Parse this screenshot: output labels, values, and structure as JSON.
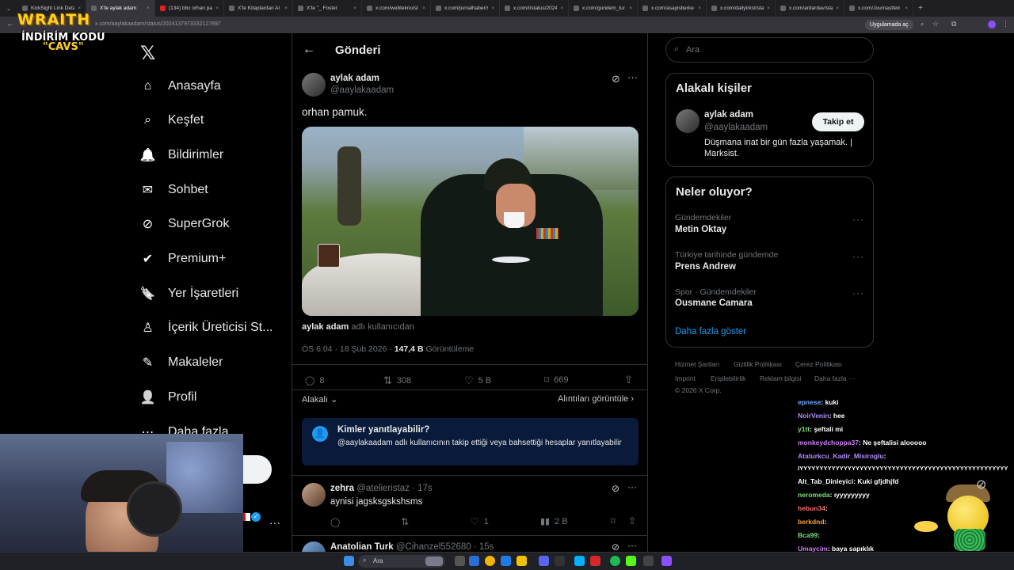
{
  "browser": {
    "tabs": [
      {
        "label": "KickSight Link Deta"
      },
      {
        "label": "X'te aylak adam"
      },
      {
        "label": "(134) bbc orhan pa"
      },
      {
        "label": "X'te Kitaplardan Al"
      },
      {
        "label": "X'te \"_ Foster"
      },
      {
        "label": "x.com/webtekno/st"
      },
      {
        "label": "x.com/jurnalhaber/st"
      },
      {
        "label": "x.com/i/status/2024"
      },
      {
        "label": "x.com/gundem_tur"
      },
      {
        "label": "x.com/asayisberke"
      },
      {
        "label": "x.com/dailytrkst/sta"
      },
      {
        "label": "x.com/ardardav/sta"
      },
      {
        "label": "x.com/Journasttetr"
      }
    ],
    "url": "x.com/aaylakaadam/status/2024137973332127897",
    "app_button": "Uygulamada aç"
  },
  "overlay": {
    "brand": "WRAITH",
    "code_line1": "İNDİRİM KODU",
    "code_line2": "\"CAVS\""
  },
  "nav": [
    {
      "label": "Anasayfa",
      "icon": "home-icon"
    },
    {
      "label": "Keşfet",
      "icon": "search-icon"
    },
    {
      "label": "Bildirimler",
      "icon": "bell-icon"
    },
    {
      "label": "Sohbet",
      "icon": "mail-icon"
    },
    {
      "label": "SuperGrok",
      "icon": "grok-icon"
    },
    {
      "label": "Premium+",
      "icon": "verified-icon"
    },
    {
      "label": "Yer İşaretleri",
      "icon": "bookmark-icon"
    },
    {
      "label": "İçerik Üreticisi St...",
      "icon": "creator-icon"
    },
    {
      "label": "Makaleler",
      "icon": "article-icon"
    },
    {
      "label": "Profil",
      "icon": "person-icon"
    },
    {
      "label": "Daha fazla",
      "icon": "more-icon"
    }
  ],
  "post_header": {
    "title": "Gönderi"
  },
  "post": {
    "name": "aylak adam",
    "handle": "@aaylakaadam",
    "text": "orhan pamuk.",
    "credit_name": "aylak adam",
    "credit_suffix": "adlı kullanıcıdan",
    "time": "ÖS 6:04 · 18 Şub 2026 ·",
    "views": "147,4 B",
    "views_label": "Görüntüleme",
    "replies": "8",
    "reposts": "308",
    "likes": "5 B",
    "bookmarks": "669",
    "sort": "Alakalı",
    "quotes": "Alıntıları görüntüle"
  },
  "reply_notice": {
    "title": "Kimler yanıtlayabilir?",
    "body": "@aaylakaadam adlı kullanıcının takip ettiği veya bahsettiği hesaplar yanıtlayabilir"
  },
  "replies": [
    {
      "name": "zehra",
      "handle": "@atelieristaz · 17s",
      "text": "aynisi jagsksgskshsms",
      "likes": "1",
      "views": "2 B"
    },
    {
      "name": "Anatolian Turk",
      "handle": "@Cihanzel552680 · 15s"
    }
  ],
  "search": {
    "placeholder": "Ara"
  },
  "relevant": {
    "title": "Alakalı kişiler",
    "name": "aylak adam",
    "handle": "@aaylakaadam",
    "bio": "Düşmana inat bir gün fazla yaşamak. | Marksist.",
    "follow": "Takip et"
  },
  "trends": {
    "title": "Neler oluyor?",
    "items": [
      {
        "context": "Gündemdekiler",
        "name": "Metin Oktay"
      },
      {
        "context": "Türkiye tarihinde gündemde",
        "name": "Prens Andrew"
      },
      {
        "context": "Spor · Gündemdekiler",
        "name": "Ousmane Camara"
      }
    ],
    "more": "Daha fazla göster"
  },
  "footer": {
    "l1": [
      "Hizmet Şartları",
      "Gizlilik Politikası",
      "Çerez Politikası"
    ],
    "l2": [
      "Imprint",
      "Erişilebilirlik",
      "Reklam bilgisi",
      "Daha fazla ···"
    ],
    "copy": "© 2026 X Corp."
  },
  "chat": [
    {
      "user": "epnese",
      "msg": ": kuki",
      "color": "#6aa9ff"
    },
    {
      "user": "NoirVenin",
      "msg": ": hee",
      "color": "#b48cff"
    },
    {
      "user": "y1tt",
      "msg": ": şeftali mi",
      "color": "#7be07b"
    },
    {
      "user": "monkeydchoppa37",
      "msg": ": Ne şeftalisi alooooo",
      "color": "#d17cff"
    },
    {
      "user": "Ataturkcu_Kadir_Misiroglu",
      "msg": ":",
      "color": "#b48cff"
    },
    {
      "user": "",
      "msg": "IYYYYYYYYYYYYYYYYYYYYYYYYYYYYYYYYYYYYYYYYYYYYYYYYYYYY",
      "color": "#ffffff"
    },
    {
      "user": "Alt_Tab_Dinleyici",
      "msg": ": Kuki gfjdhjfd",
      "color": "#ffffff"
    },
    {
      "user": "neromeda",
      "msg": ": ıyyyyyyyyy",
      "color": "#7be07b"
    },
    {
      "user": "hebun34",
      "msg": ":",
      "color": "#ff6b6b"
    },
    {
      "user": "berkdnd",
      "msg": ":",
      "color": "#ff9a3c"
    },
    {
      "user": "Bca99",
      "msg": ":",
      "color": "#7be07b"
    },
    {
      "user": "Umaycim",
      "msg": ": baya sapıklık",
      "color": "#d17cff"
    }
  ],
  "taskbar": {
    "search": "Ara"
  }
}
